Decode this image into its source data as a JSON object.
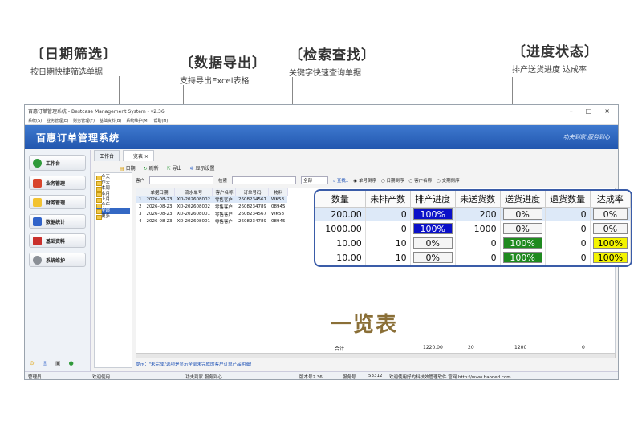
{
  "features": [
    {
      "title": "〔日期筛选〕",
      "sub": "按日期快捷筛选单据"
    },
    {
      "title": "〔数据导出〕",
      "sub": "支持导出Excel表格"
    },
    {
      "title": "〔检索查找〕",
      "sub": "关键字快速查询单据"
    },
    {
      "title": "〔进度状态〕",
      "sub": "排产送货进度 达成率"
    }
  ],
  "window": {
    "title": "百惠订单管理系统 - Bestcase Management System - v2.36",
    "ctrl": {
      "min": "–",
      "max": "□",
      "close": "×"
    },
    "menus": [
      "系统(S)",
      "业务管理(E)",
      "财务管理(F)",
      "基础资料(B)",
      "系统维护(M)",
      "帮助(H)"
    ],
    "banner": "百惠订单管理系统",
    "slogan": "功夫到家 服务到心"
  },
  "sidebar": [
    "工作台",
    "业务管理",
    "财务管理",
    "数据统计",
    "基础资料",
    "系统维护"
  ],
  "sidebar_icons": [
    "⊙",
    "◎",
    "▣",
    "●"
  ],
  "tabs": [
    {
      "label": "工作台"
    },
    {
      "label": "一览表 ×"
    }
  ],
  "toolbar": {
    "date": "日期",
    "refresh": "刷新",
    "export": "导出",
    "display": "显示设置"
  },
  "tree": [
    "今天",
    "昨天",
    "本周",
    "本月",
    "上月",
    "今年",
    "全部",
    "更多.."
  ],
  "filter": {
    "customer": "客户",
    "search": "检索",
    "all": "全部",
    "find": "查找..",
    "sort": [
      "单号倒序",
      "日期倒序",
      "客户名称",
      "交期倒序"
    ]
  },
  "grid": {
    "headers": [
      "",
      "单据日期",
      "流水单号",
      "客户名称",
      "订单号码",
      "物料"
    ],
    "rows": [
      [
        "1",
        "2026-08-23",
        "XD-202608002",
        "零售客户",
        "2608234567",
        "WK58"
      ],
      [
        "2",
        "2026-08-23",
        "XD-202608002",
        "零售客户",
        "2608234789",
        "08945"
      ],
      [
        "3",
        "2026-08-23",
        "XD-202608001",
        "零售客户",
        "2608234567",
        "WK58"
      ],
      [
        "4",
        "2026-08-23",
        "XD-202608001",
        "零售客户",
        "2608234789",
        "08945"
      ]
    ]
  },
  "totals": {
    "label": "合计",
    "qty": "1220.00",
    "unscheduled": "20",
    "unsent": "1200",
    "returned": "0"
  },
  "hint": "提示：\"未完成\"选项是显示全部未完成的客户订单产品明细!",
  "status": {
    "user": "管理员",
    "welcome": "欢迎使用",
    "slogan": "功夫到家 服务到心",
    "version": "版本号2.36",
    "service_label": "服务号",
    "service_no": "53312",
    "thanks": "欢迎使用好的科技效管理软件 官网 http://www.haoded.com"
  },
  "big_label": "一览表",
  "zoom": {
    "headers": [
      "数量",
      "未排产数",
      "排产进度",
      "未送货数",
      "送货进度",
      "退货数量",
      "达成率"
    ],
    "rows": [
      {
        "qty": "200.00",
        "unscheduled": "0",
        "sched": "100%",
        "sched_color": "blue",
        "unsent": "200",
        "deliv": "0%",
        "deliv_color": "white",
        "ret": "0",
        "rate": "0%",
        "rate_color": "white"
      },
      {
        "qty": "1000.00",
        "unscheduled": "0",
        "sched": "100%",
        "sched_color": "blue",
        "unsent": "1000",
        "deliv": "0%",
        "deliv_color": "white",
        "ret": "0",
        "rate": "0%",
        "rate_color": "white"
      },
      {
        "qty": "10.00",
        "unscheduled": "10",
        "sched": "0%",
        "sched_color": "white",
        "unsent": "0",
        "deliv": "100%",
        "deliv_color": "green",
        "ret": "0",
        "rate": "100%",
        "rate_color": "yellow"
      },
      {
        "qty": "10.00",
        "unscheduled": "10",
        "sched": "0%",
        "sched_color": "white",
        "unsent": "0",
        "deliv": "100%",
        "deliv_color": "green",
        "ret": "0",
        "rate": "100%",
        "rate_color": "yellow"
      }
    ]
  },
  "colors": {
    "accent": "#2256ae",
    "blue_bar": "#0a10c8",
    "green_bar": "#1f8a1f",
    "yellow_bar": "#f4f400"
  }
}
